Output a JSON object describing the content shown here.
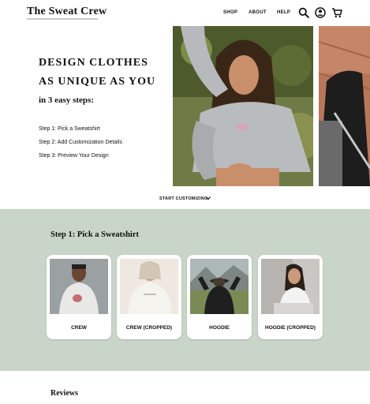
{
  "header": {
    "brand": "The Sweat Crew",
    "nav": [
      {
        "label": "SHOP"
      },
      {
        "label": "ABOUT"
      },
      {
        "label": "HELP"
      }
    ],
    "icons": [
      "search-icon",
      "account-icon",
      "cart-icon"
    ]
  },
  "hero": {
    "title_line1": "DESIGN CLOTHES",
    "title_line2": "AS UNIQUE AS YOU",
    "subtitle": "in 3 easy steps:",
    "steps": [
      "Step 1: Pick a Sweatshirt",
      "Step 2: Add Customization Details",
      "Step 3: Preview Your Design"
    ],
    "cta": "START CUSTOMIZING"
  },
  "step_section": {
    "heading": "Step 1: Pick a Sweatshirt",
    "background": "#c9d5c9",
    "cards": [
      {
        "label": "CREW"
      },
      {
        "label": "CREW (CROPPED)"
      },
      {
        "label": "HOODIE"
      },
      {
        "label": "HOODIE (CROPPED)"
      }
    ]
  },
  "reviews": {
    "heading": "Reviews"
  }
}
